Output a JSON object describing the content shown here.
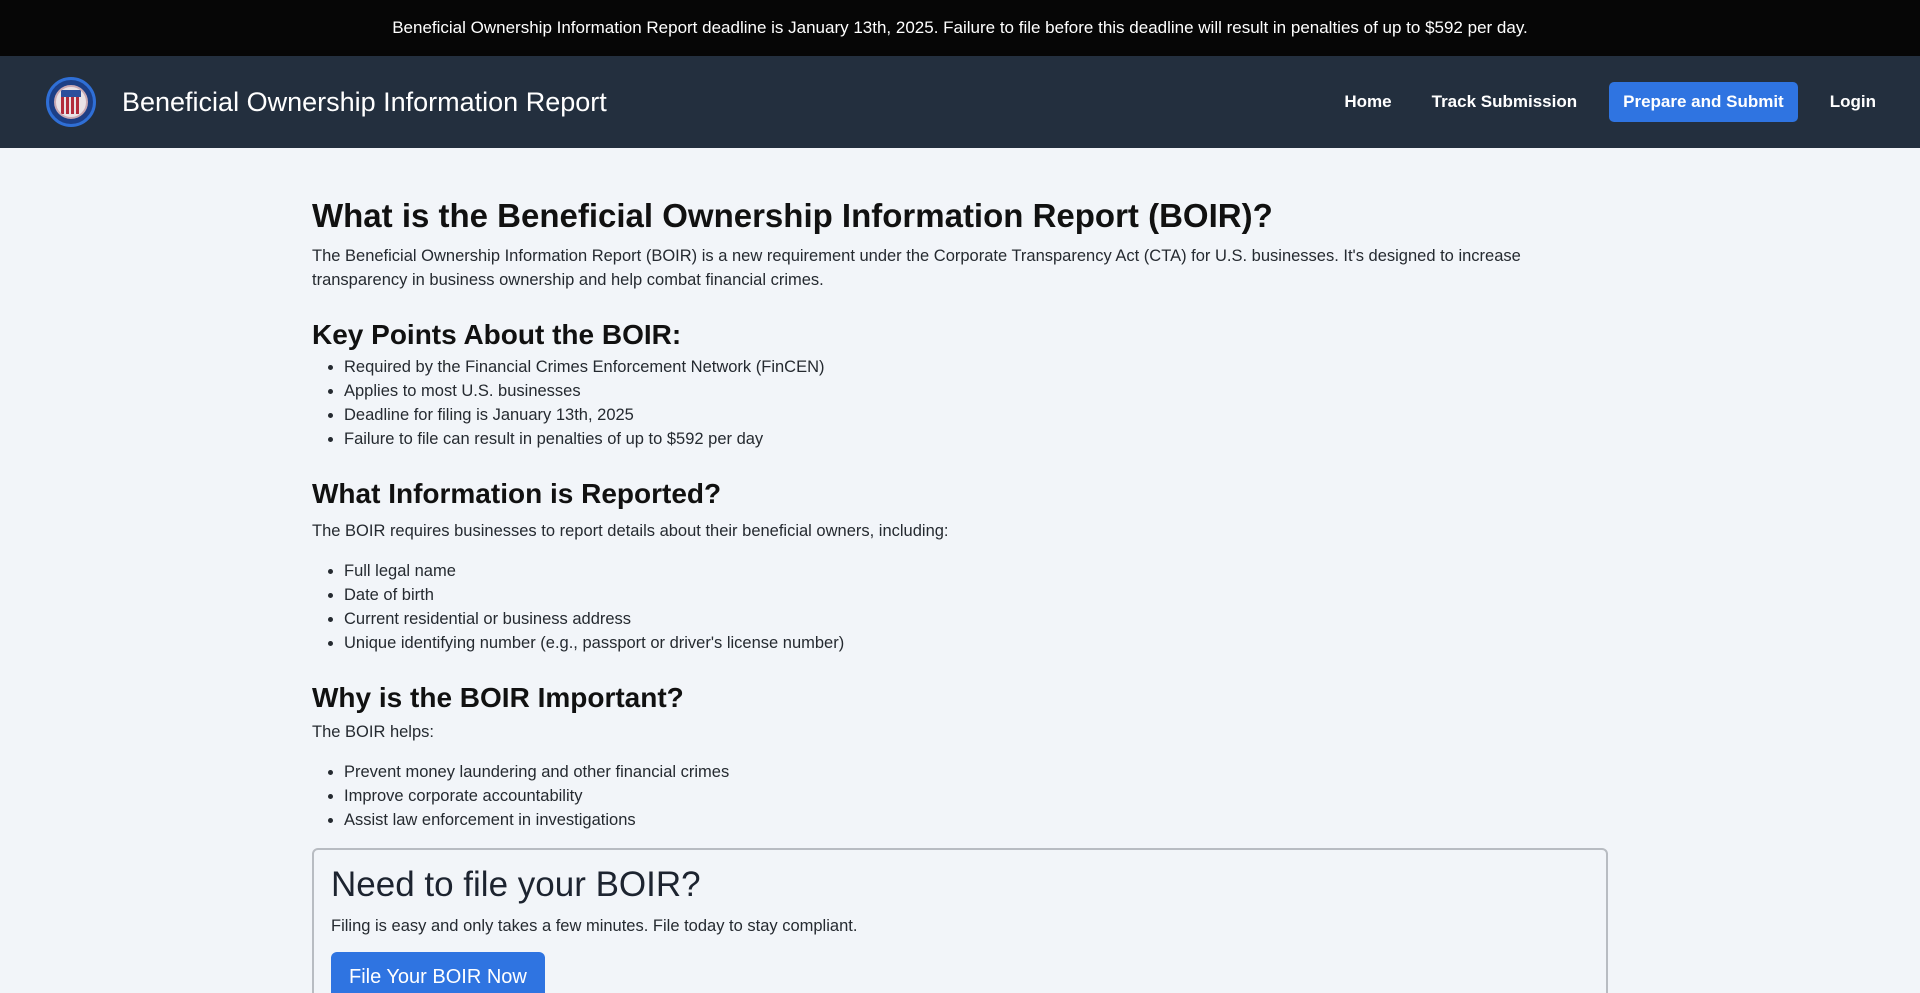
{
  "announcement": "Beneficial Ownership Information Report deadline is January 13th, 2025. Failure to file before this deadline will result in penalties of up to $592 per day.",
  "header": {
    "title": "Beneficial Ownership Information Report",
    "logo_icon": "seal-icon",
    "nav": {
      "home": "Home",
      "track": "Track Submission",
      "prepare": "Prepare and Submit",
      "login": "Login"
    }
  },
  "colors": {
    "announcement_bg": "#060606",
    "navbar_bg": "#232f3e",
    "accent": "#2f74e1",
    "page_bg": "#f2f5f9"
  },
  "main": {
    "intro": {
      "heading": "What is the Beneficial Ownership Information Report (BOIR)?",
      "text": "The Beneficial Ownership Information Report (BOIR) is a new requirement under the Corporate Transparency Act (CTA) for U.S. businesses. It's designed to increase transparency in business ownership and help combat financial crimes."
    },
    "key_points": {
      "heading": "Key Points About the BOIR:",
      "items": [
        "Required by the Financial Crimes Enforcement Network (FinCEN)",
        "Applies to most U.S. businesses",
        "Deadline for filing is January 13th, 2025",
        "Failure to file can result in penalties of up to $592 per day"
      ]
    },
    "info_reported": {
      "heading": "What Information is Reported?",
      "text": "The BOIR requires businesses to report details about their beneficial owners, including:",
      "items": [
        "Full legal name",
        "Date of birth",
        "Current residential or business address",
        "Unique identifying number (e.g., passport or driver's license number)"
      ]
    },
    "importance": {
      "heading": "Why is the BOIR Important?",
      "text": "The BOIR helps:",
      "items": [
        "Prevent money laundering and other financial crimes",
        "Improve corporate accountability",
        "Assist law enforcement in investigations"
      ]
    },
    "cta": {
      "heading": "Need to file your BOIR?",
      "text": "Filing is easy and only takes a few minutes. File today to stay compliant.",
      "button": "File Your BOIR Now"
    }
  }
}
